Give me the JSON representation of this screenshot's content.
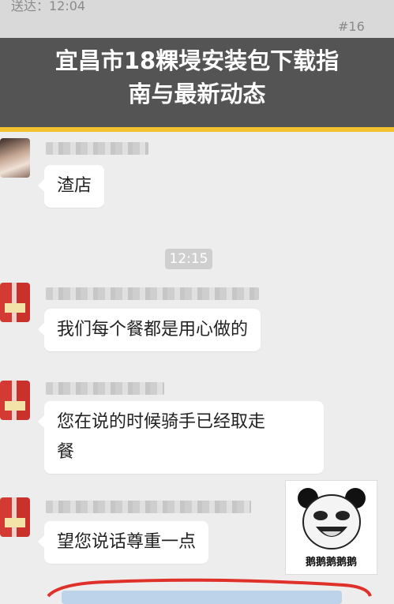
{
  "header": {
    "faint_left": "送达：12:04",
    "faint_tag": "#16"
  },
  "banner": {
    "title_line1": "宜昌市18粿埐安装包下载指",
    "title_line2": "南与最新动态"
  },
  "chat": {
    "time": "12:15",
    "messages": [
      {
        "sender": "customer",
        "text": "渣店"
      },
      {
        "sender": "merchant",
        "text": "我们每个餐都是用心做的"
      },
      {
        "sender": "merchant",
        "text_line1": "您在说的时候骑手已经取走",
        "text_line2": "餐"
      },
      {
        "sender": "merchant",
        "text": "望您说话尊重一点"
      }
    ],
    "sticker_caption": "鹅鹅鹅鹅鹅"
  },
  "colors": {
    "banner_bg": "#373737",
    "accent_line": "#f2c230",
    "chat_bg": "#ededed",
    "bubble_bg": "#ffffff"
  }
}
